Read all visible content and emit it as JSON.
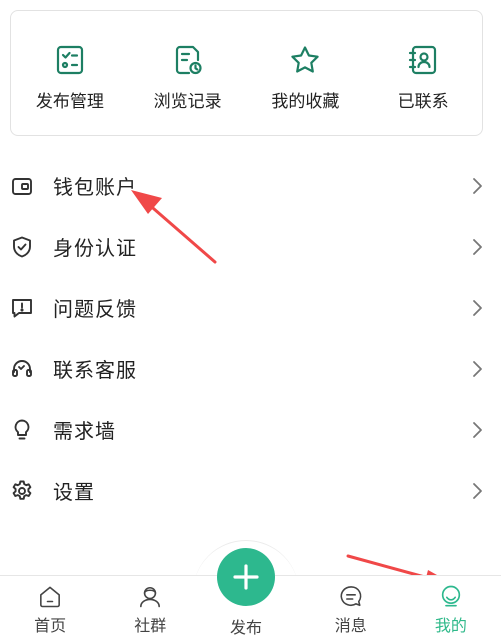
{
  "quick_actions": [
    {
      "label": "发布管理",
      "icon": "checklist-icon"
    },
    {
      "label": "浏览记录",
      "icon": "history-doc-icon"
    },
    {
      "label": "我的收藏",
      "icon": "star-icon"
    },
    {
      "label": "已联系",
      "icon": "contact-book-icon"
    }
  ],
  "menu": [
    {
      "label": "钱包账户",
      "icon": "wallet-icon"
    },
    {
      "label": "身份认证",
      "icon": "shield-check-icon"
    },
    {
      "label": "问题反馈",
      "icon": "feedback-icon"
    },
    {
      "label": "联系客服",
      "icon": "headset-icon"
    },
    {
      "label": "需求墙",
      "icon": "lightbulb-icon"
    },
    {
      "label": "设置",
      "icon": "gear-icon"
    }
  ],
  "tabbar": {
    "home": "首页",
    "community": "社群",
    "publish": "发布",
    "messages": "消息",
    "mine": "我的",
    "active": "mine"
  },
  "colors": {
    "accent": "#2db88e",
    "annotation_arrow": "#f04848"
  }
}
